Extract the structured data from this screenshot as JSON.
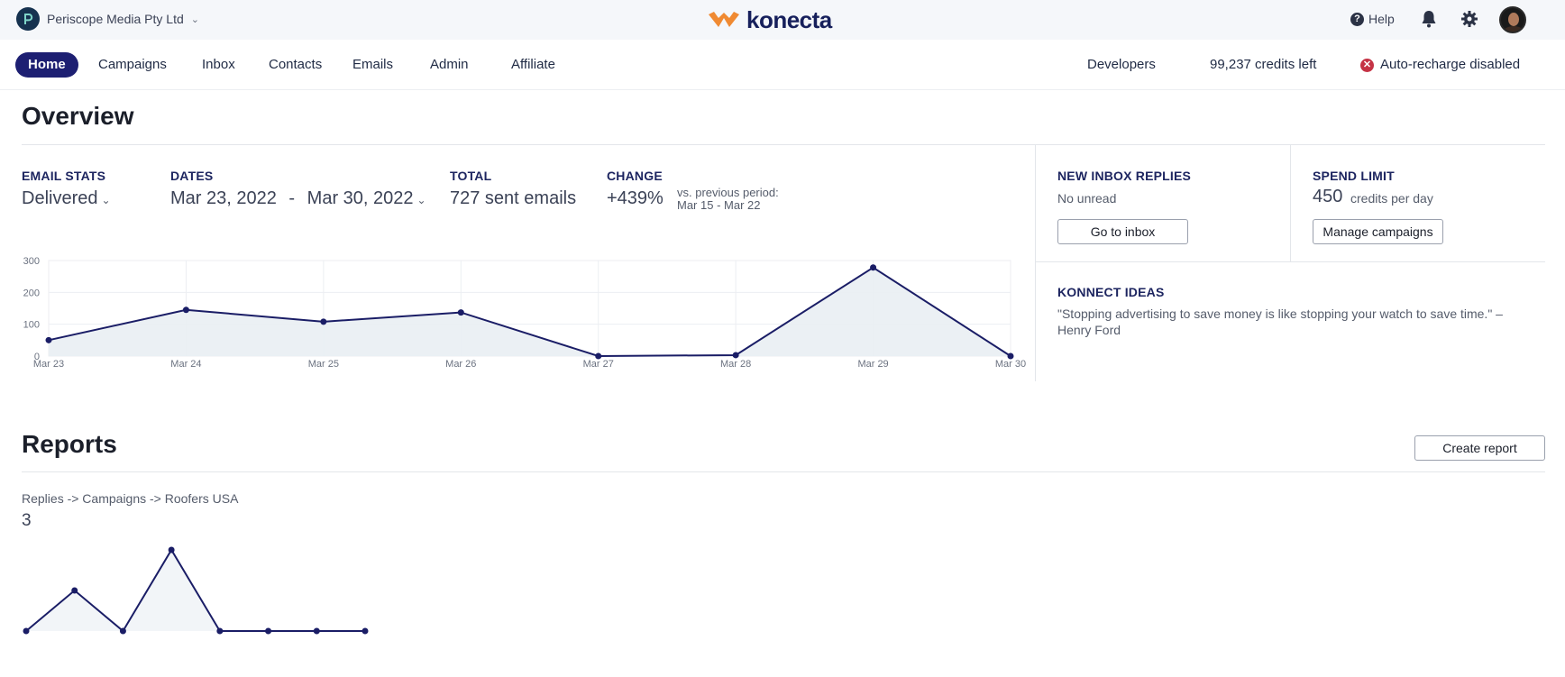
{
  "topbar": {
    "org_name": "Periscope Media Pty Ltd",
    "org_logo_letter": "P",
    "org_icon": "chevron-down-icon",
    "brand": "konecta",
    "help_label": "Help",
    "icons": [
      "help-icon",
      "bell-icon",
      "gear-icon",
      "avatar"
    ]
  },
  "nav": {
    "items": [
      {
        "label": "Home",
        "active": true
      },
      {
        "label": "Campaigns"
      },
      {
        "label": "Inbox"
      },
      {
        "label": "Contacts"
      },
      {
        "label": "Emails"
      },
      {
        "label": "Admin"
      },
      {
        "label": "Affiliate"
      }
    ],
    "developers": "Developers",
    "credits": "99,237 credits left",
    "recharge": "Auto-recharge disabled"
  },
  "overview": {
    "title": "Overview",
    "email_stats_label": "EMAIL STATS",
    "email_stats_value": "Delivered",
    "dates_label": "DATES",
    "date_from": "Mar 23, 2022",
    "date_sep": "-",
    "date_to": "Mar 30, 2022",
    "total_label": "TOTAL",
    "total_value": "727 sent emails",
    "change_label": "CHANGE",
    "change_value": "+439%",
    "change_note_1": "vs. previous period:",
    "change_note_2": "Mar 15 - Mar 22"
  },
  "inbox_panel": {
    "label": "NEW INBOX REPLIES",
    "status": "No unread",
    "button": "Go to inbox"
  },
  "spend_panel": {
    "label": "SPEND LIMIT",
    "value": "450",
    "unit": "credits per day",
    "button": "Manage campaigns"
  },
  "ideas_panel": {
    "label": "KONNECT IDEAS",
    "quote": "\"Stopping advertising to save money is like stopping your watch to save time.\" –Henry Ford"
  },
  "reports": {
    "title": "Reports",
    "create_button": "Create report",
    "report_path": "Replies -> Campaigns -> Roofers USA",
    "report_total": "3"
  },
  "colors": {
    "accent": "#1d1f72",
    "line": "#1a1d66",
    "area": "#e9eef3",
    "danger": "#c53345"
  },
  "chart_data": [
    {
      "type": "area",
      "categories": [
        "Mar 23",
        "Mar 24",
        "Mar 25",
        "Mar 26",
        "Mar 27",
        "Mar 28",
        "Mar 29",
        "Mar 30"
      ],
      "values": [
        50,
        145,
        108,
        137,
        0,
        3,
        278,
        0
      ],
      "y_ticks": [
        0,
        100,
        200,
        300
      ],
      "ylim": [
        0,
        300
      ],
      "grid": true
    },
    {
      "type": "area",
      "values": [
        0,
        1,
        0,
        2,
        0,
        0,
        0,
        0
      ],
      "ylim": [
        0,
        2
      ],
      "grid": false
    }
  ]
}
